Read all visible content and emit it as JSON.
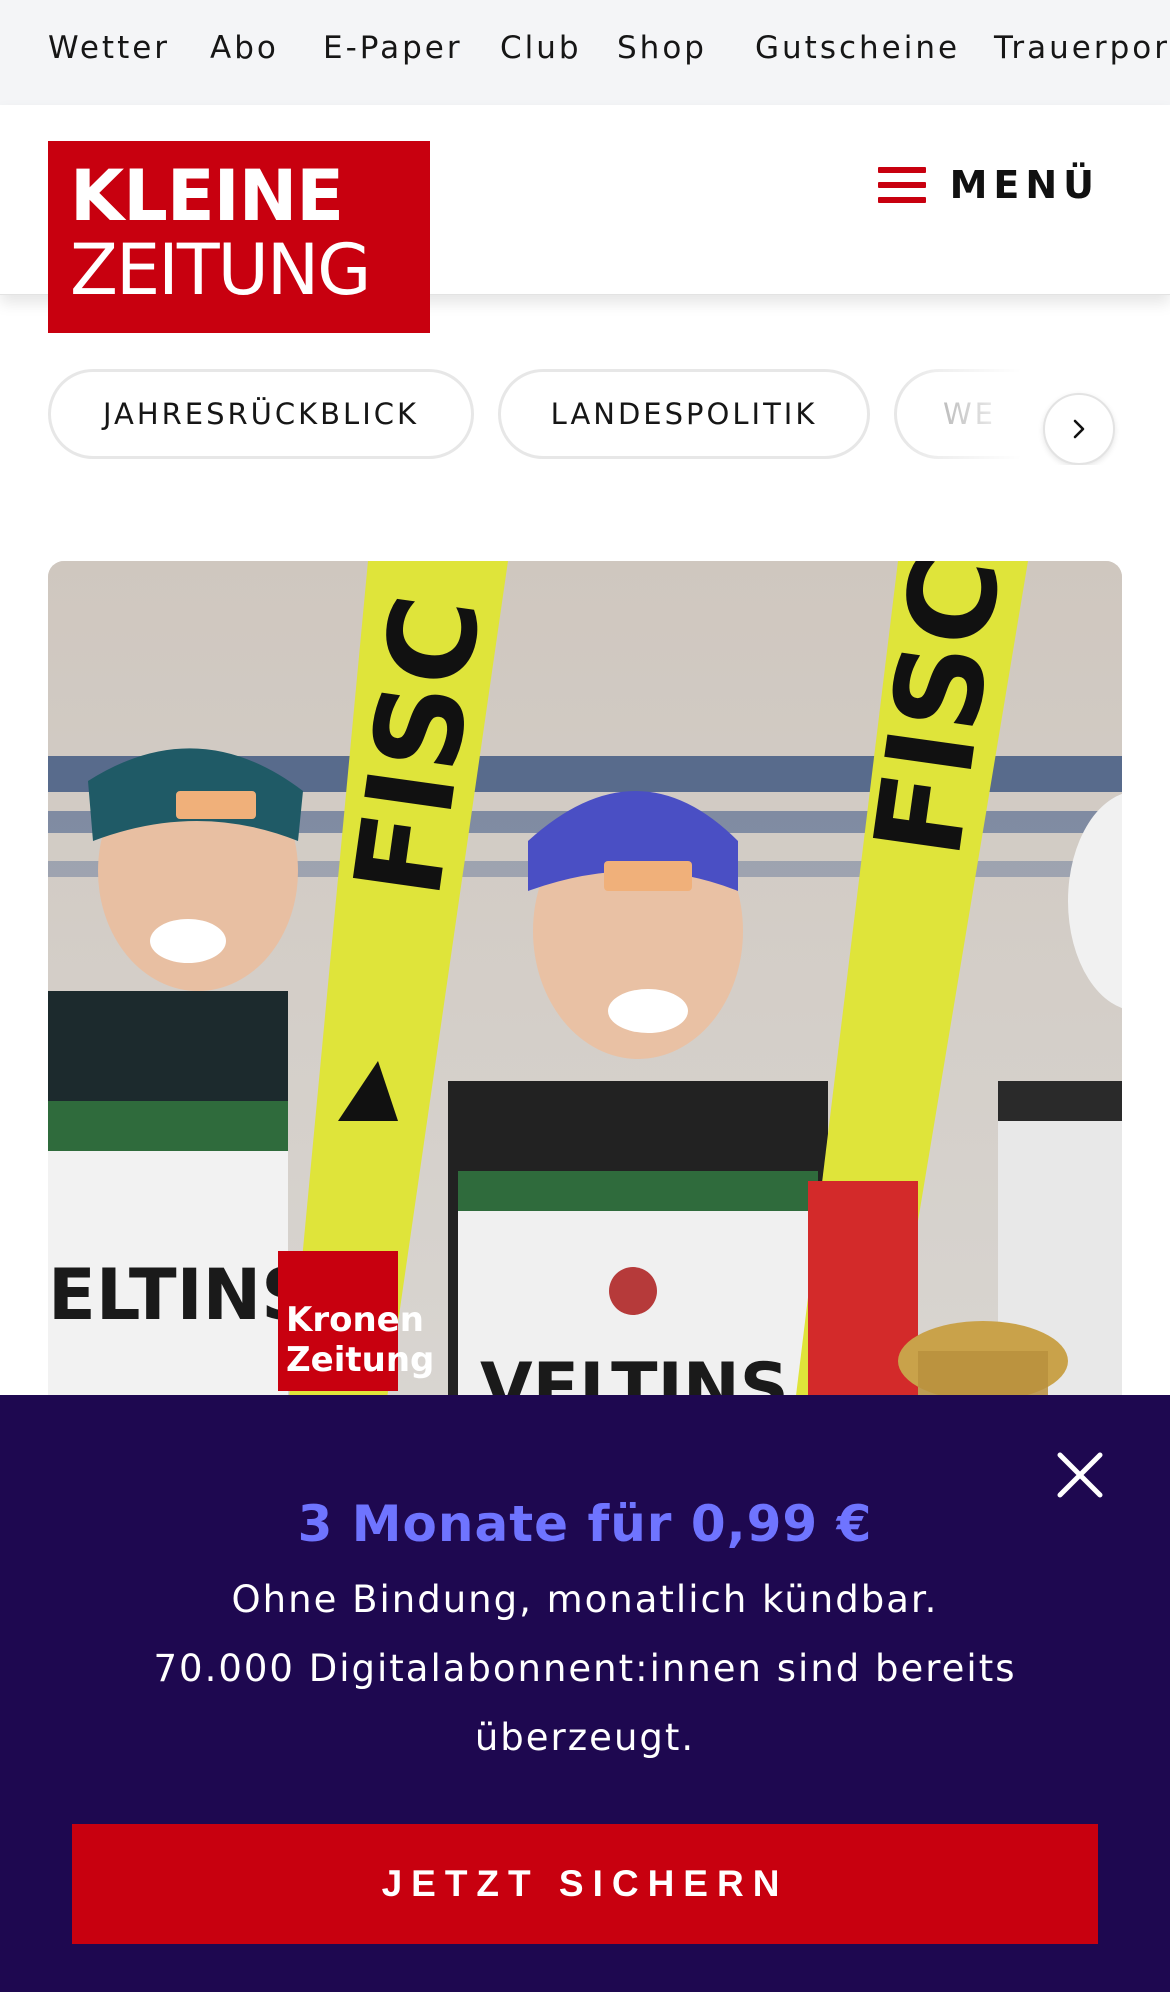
{
  "topnav": {
    "items": [
      "Wetter",
      "Abo",
      "E-Paper",
      "Club",
      "Shop",
      "Gutscheine",
      "Trauerportal"
    ]
  },
  "header": {
    "logo_line1": "KLEINE",
    "logo_line2": "ZEITUNG",
    "menu_label": "MENÜ",
    "menu_icon": "hamburger-icon",
    "brand_color": "#c8000f"
  },
  "categories": {
    "items": [
      "JAHRESRÜCKBLICK",
      "LANDESPOLITIK",
      "WE"
    ],
    "next_icon": "chevron-right-icon"
  },
  "hero": {
    "jersey_1": "ELTINS",
    "jersey_2": "VELTINS",
    "ski_brand": "FISCHER",
    "bib_text": "Kronen Zeitung"
  },
  "paywall": {
    "title": "3 Monate für 0,99 €",
    "line1": "Ohne Bindung, monatlich kündbar.",
    "line2": "70.000 Digitalabonnent:innen sind bereits überzeugt.",
    "cta_label": "JETZT SICHERN",
    "close_icon": "close-icon",
    "background_color": "#1e0850",
    "title_color": "#6f74ff"
  }
}
